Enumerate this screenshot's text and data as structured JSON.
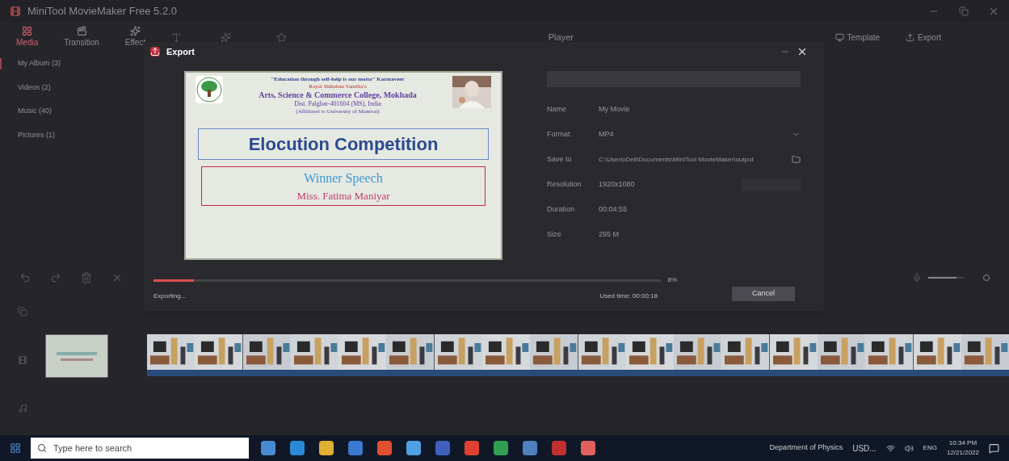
{
  "window": {
    "title": "MiniTool MovieMaker Free 5.2.0"
  },
  "toolbar": [
    {
      "label": "Media",
      "selected": true
    },
    {
      "label": "Transition",
      "selected": false
    },
    {
      "label": "Effect",
      "selected": false
    }
  ],
  "player": {
    "title": "Player"
  },
  "top_actions": [
    "Template",
    "Export"
  ],
  "library": [
    {
      "label": "My Album (3)",
      "selected": true
    },
    {
      "label": "Videos (2)",
      "selected": false
    },
    {
      "label": "Music (40)",
      "selected": false
    },
    {
      "label": "Pictures (1)",
      "selected": false
    }
  ],
  "dialog": {
    "title": "Export",
    "slide": {
      "motto": "\"Education through self-help is our motto\" Karmaveer",
      "society": "Rayat Shikshan Sanstha's",
      "college": "Arts, Science & Commerce College, Mokhada",
      "address": "Dist. Palghar-401604 (MS), India",
      "affiliation": "(Affiliated to University of Mumbai)",
      "heading": "Elocution Competition",
      "subtitle": "Winner Speech",
      "name": "Miss. Fatima Maniyar"
    },
    "fields": [
      {
        "label": "Name",
        "value": "My Movie",
        "kind": "text"
      },
      {
        "label": "Format",
        "value": "MP4",
        "kind": "select"
      },
      {
        "label": "Save to",
        "value": "C:\\Users\\Dell\\Documents\\MiniTool MovieMaker\\output",
        "kind": "folder"
      },
      {
        "label": "Resolution",
        "value": "1920x1080",
        "kind": "setting"
      },
      {
        "label": "Duration",
        "value": "00:04:55",
        "kind": "text"
      },
      {
        "label": "Size",
        "value": "295 M",
        "kind": "text"
      }
    ],
    "progress": {
      "level": 0.08,
      "percent": "8%",
      "status": "Exporting...",
      "used_time": "Used time: 00:00:18"
    },
    "cancel": "Cancel"
  },
  "timeline": {
    "zoom": {
      "level": 0.8
    }
  },
  "taskbar": {
    "search_placeholder": "Type here to search",
    "location": "Department of Physics",
    "currency": "USD...",
    "language": "ENG",
    "time": "10:34 PM",
    "date": "12/21/2022"
  }
}
